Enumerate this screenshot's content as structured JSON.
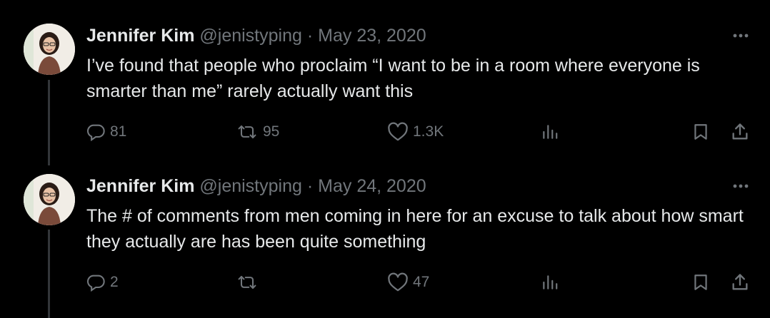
{
  "tweets": [
    {
      "author": "Jennifer Kim",
      "handle": "@jenistyping",
      "separator": "·",
      "date": "May 23, 2020",
      "text": "I’ve found that people who proclaim “I want to be in a room where everyone is smarter than me” rarely actually want this",
      "replies": "81",
      "retweets": "95",
      "likes": "1.3K"
    },
    {
      "author": "Jennifer Kim",
      "handle": "@jenistyping",
      "separator": "·",
      "date": "May 24, 2020",
      "text": "The # of comments from men coming in here for an excuse to talk about how smart they actually are has been quite something",
      "replies": "2",
      "retweets": "",
      "likes": "47"
    }
  ],
  "icons": {
    "more": "more-icon",
    "reply": "reply-icon",
    "retweet": "retweet-icon",
    "like": "heart-icon",
    "views": "analytics-icon",
    "bookmark": "bookmark-icon",
    "share": "share-icon"
  },
  "colors": {
    "background": "#000000",
    "primary_text": "#e7e9ea",
    "secondary_text": "#71767b",
    "thread_line": "#333639"
  }
}
